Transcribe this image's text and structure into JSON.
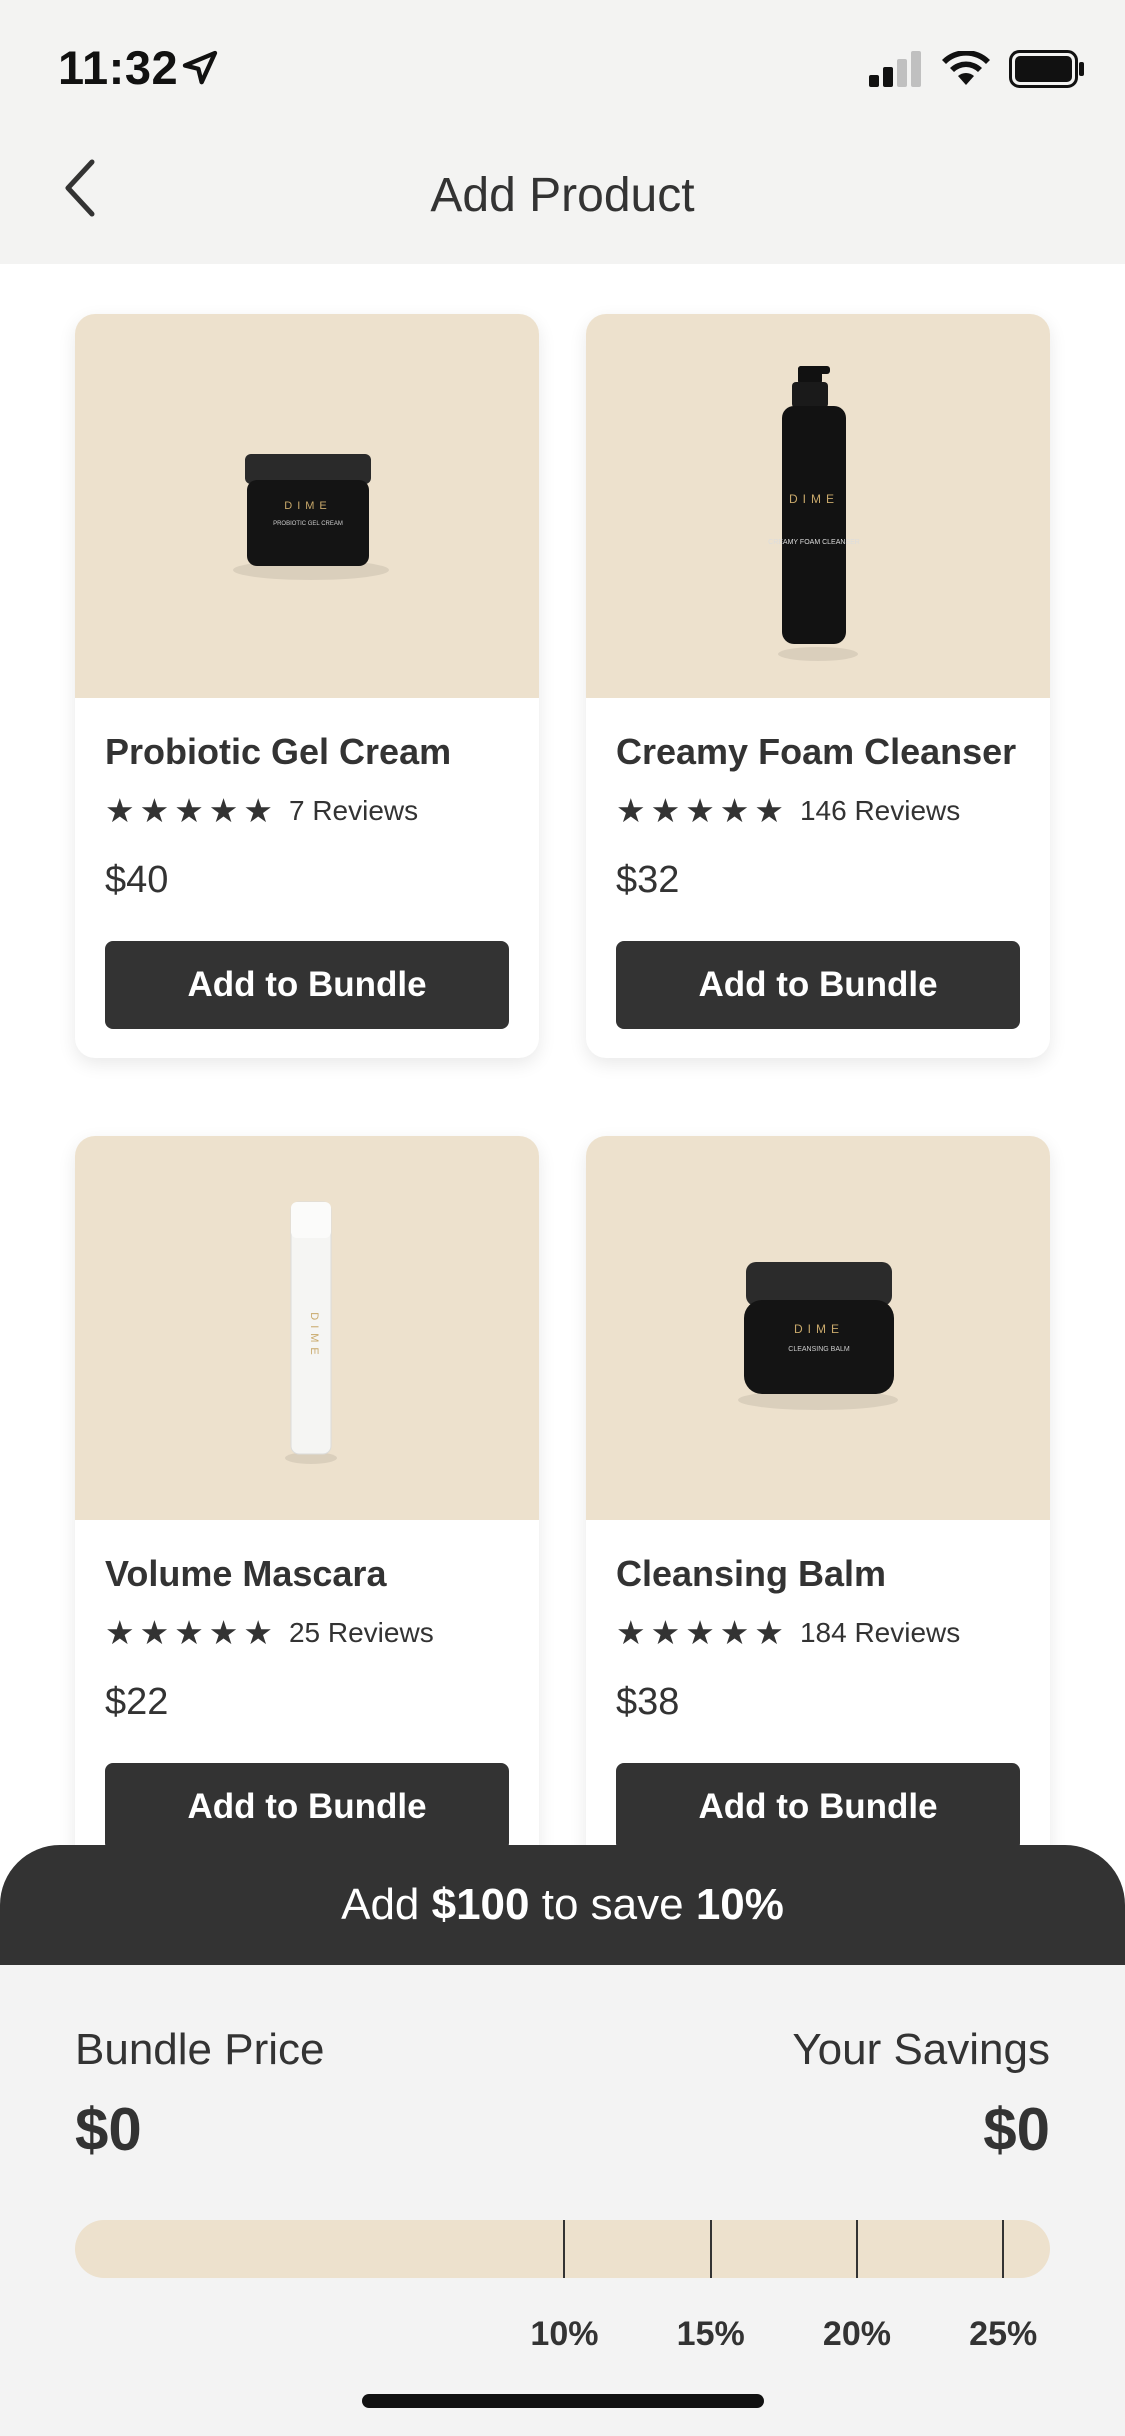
{
  "status_bar": {
    "time": "11:32"
  },
  "header": {
    "title": "Add Product"
  },
  "products": [
    {
      "name": "Probiotic Gel Cream",
      "stars": 5,
      "reviews": "7 Reviews",
      "price": "$40",
      "button": "Add to Bundle",
      "product_type": "jar",
      "brand": "DIME",
      "label": "PROBIOTIC GEL CREAM"
    },
    {
      "name": "Creamy Foam Cleanser",
      "stars": 5,
      "reviews": "146 Reviews",
      "price": "$32",
      "button": "Add to Bundle",
      "product_type": "pump-bottle",
      "brand": "DIME",
      "label": "CREAMY FOAM CLEANSER"
    },
    {
      "name": "Volume Mascara",
      "stars": 5,
      "reviews": "25 Reviews",
      "price": "$22",
      "button": "Add to Bundle",
      "product_type": "tube",
      "brand": "DIME",
      "label": ""
    },
    {
      "name": "Cleansing Balm",
      "stars": 5,
      "reviews": "184 Reviews",
      "price": "$38",
      "button": "Add to Bundle",
      "product_type": "jar",
      "brand": "DIME",
      "label": "CLEANSING BALM"
    }
  ],
  "bundle": {
    "banner_prefix": "Add ",
    "banner_amount": "$100",
    "banner_middle": " to save ",
    "banner_percent": "10%",
    "price_label": "Bundle Price",
    "price_value": "$0",
    "savings_label": "Your Savings",
    "savings_value": "$0",
    "progress_fraction": 0,
    "ticks": [
      {
        "label": "10%",
        "fraction": 0.502
      },
      {
        "label": "15%",
        "fraction": 0.652
      },
      {
        "label": "20%",
        "fraction": 0.802
      },
      {
        "label": "25%",
        "fraction": 0.952
      }
    ]
  },
  "colors": {
    "accent_dark": "#333333",
    "beige": "#ede1cd",
    "panel_bg": "#f3f3f3"
  },
  "icons": {
    "back": "chevron-left-icon",
    "location": "location-arrow-icon",
    "signal": "signal-icon",
    "wifi": "wifi-icon",
    "battery": "battery-icon",
    "star": "star-icon"
  }
}
